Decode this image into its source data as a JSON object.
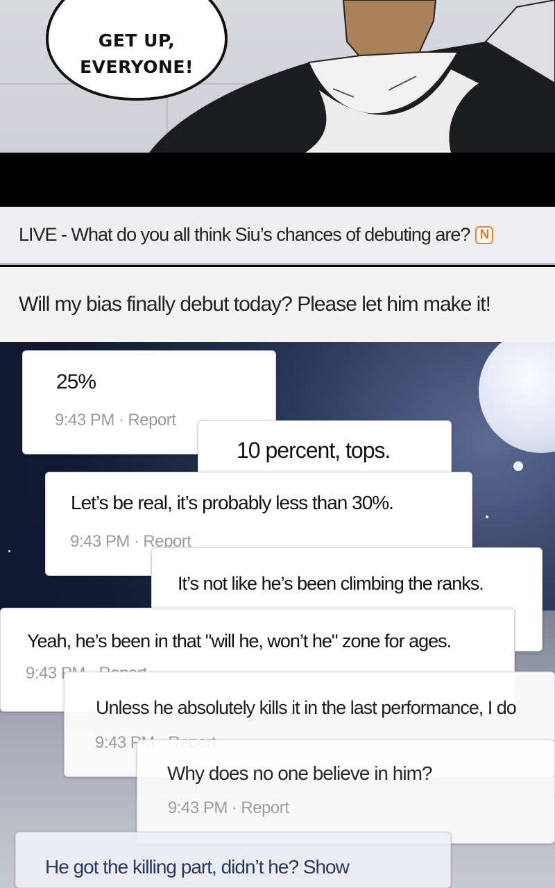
{
  "comic_panel": {
    "speech_bubble": "GET UP,\nEVERYONE!"
  },
  "live_bar": {
    "title": "LIVE - What do you all think Siu’s chances of debuting are?",
    "badge": "N",
    "badge_color": "#e0781f"
  },
  "question": "Will my bias finally debut today? Please let him make it!",
  "comments": [
    {
      "text": "25%",
      "time": "9:43 PM",
      "report": "Report"
    },
    {
      "text": "10 percent, tops."
    },
    {
      "text": "Let’s be real, it’s probably less than 30%.",
      "time": "9:43 PM",
      "report": "Report"
    },
    {
      "text": "It’s not like he’s been climbing the ranks."
    },
    {
      "text": "Yeah, he’s been in that \"will he, won’t he\" zone for ages.",
      "time": "9:43 PM",
      "report": "Report"
    },
    {
      "text": "Unless he absolutely kills it in the last performance, I do",
      "time": "9:43 PM",
      "report": "Report"
    },
    {
      "text": "Why does no one believe in him?",
      "time": "9:43 PM",
      "report": "Report"
    },
    {
      "text": "He got the killing part, didn’t he? Show"
    }
  ],
  "meta_separator": "·"
}
